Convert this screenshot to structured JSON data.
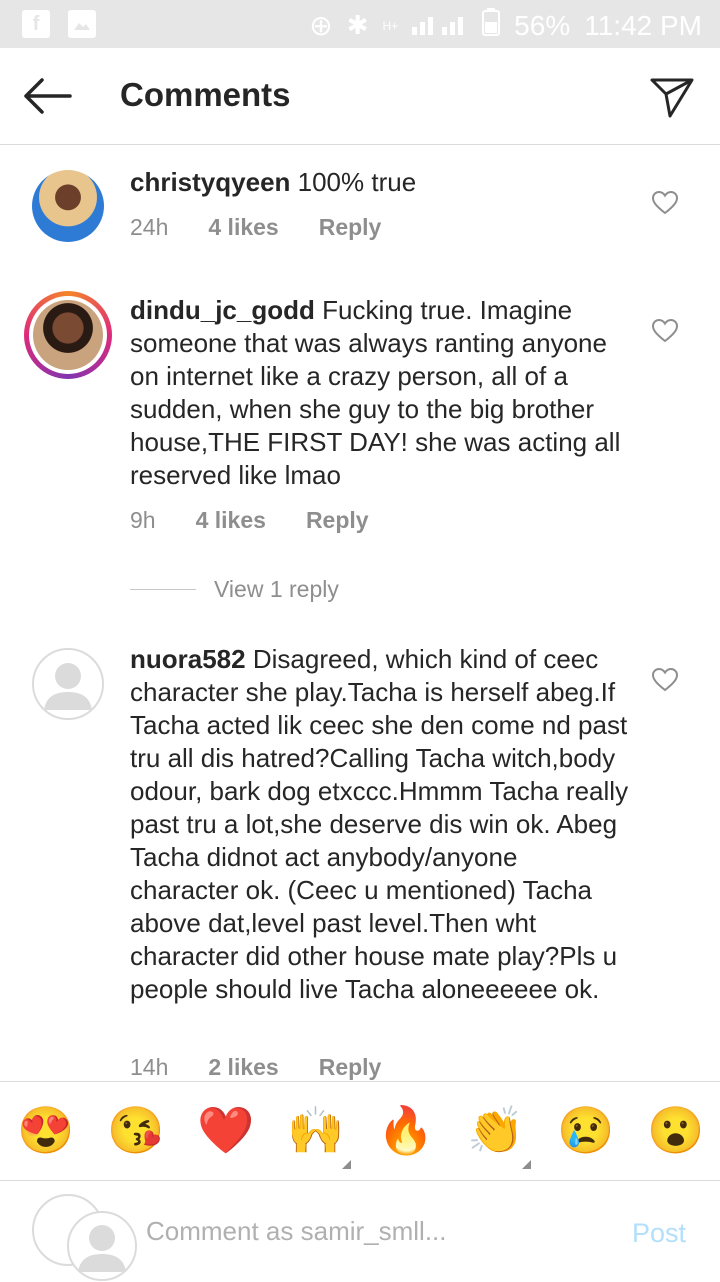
{
  "status_bar": {
    "battery": "56%",
    "time": "11:42 PM",
    "network": "H+"
  },
  "header": {
    "title": "Comments"
  },
  "comments": [
    {
      "username": "christyqyeen",
      "text": "100% true",
      "time": "24h",
      "likes": "4 likes",
      "reply": "Reply"
    },
    {
      "username": "dindu_jc_godd",
      "text": "Fucking true. Imagine someone that was always ranting anyone on internet like a crazy person, all of a sudden, when she guy to the big brother house,THE FIRST DAY! she was acting all reserved like lmao",
      "time": "9h",
      "likes": "4 likes",
      "reply": "Reply",
      "view_replies": "View 1 reply"
    },
    {
      "username": "nuora582",
      "text": "Disagreed, which kind of ceec character she play.Tacha is herself abeg.If Tacha acted lik ceec she den come nd past tru all dis hatred?Calling Tacha witch,body odour, bark dog etxccc.Hmmm Tacha really past tru a lot,she deserve dis win ok. Abeg Tacha didnot act anybody/anyone character ok. (Ceec u mentioned) Tacha above dat,level past level.Then wht character did other house mate play?Pls u people should live Tacha aloneeeeee ok.",
      "time": "14h",
      "likes": "2 likes",
      "reply": "Reply"
    }
  ],
  "emoji_bar": [
    "😍",
    "😘",
    "❤️",
    "🙌",
    "🔥",
    "👏",
    "😢",
    "😮"
  ],
  "composer": {
    "placeholder": "Comment as samir_smll...",
    "post_label": "Post"
  },
  "colors": {
    "link_disabled": "#b2dffc",
    "muted": "#8e8e8e",
    "text": "#262626"
  }
}
